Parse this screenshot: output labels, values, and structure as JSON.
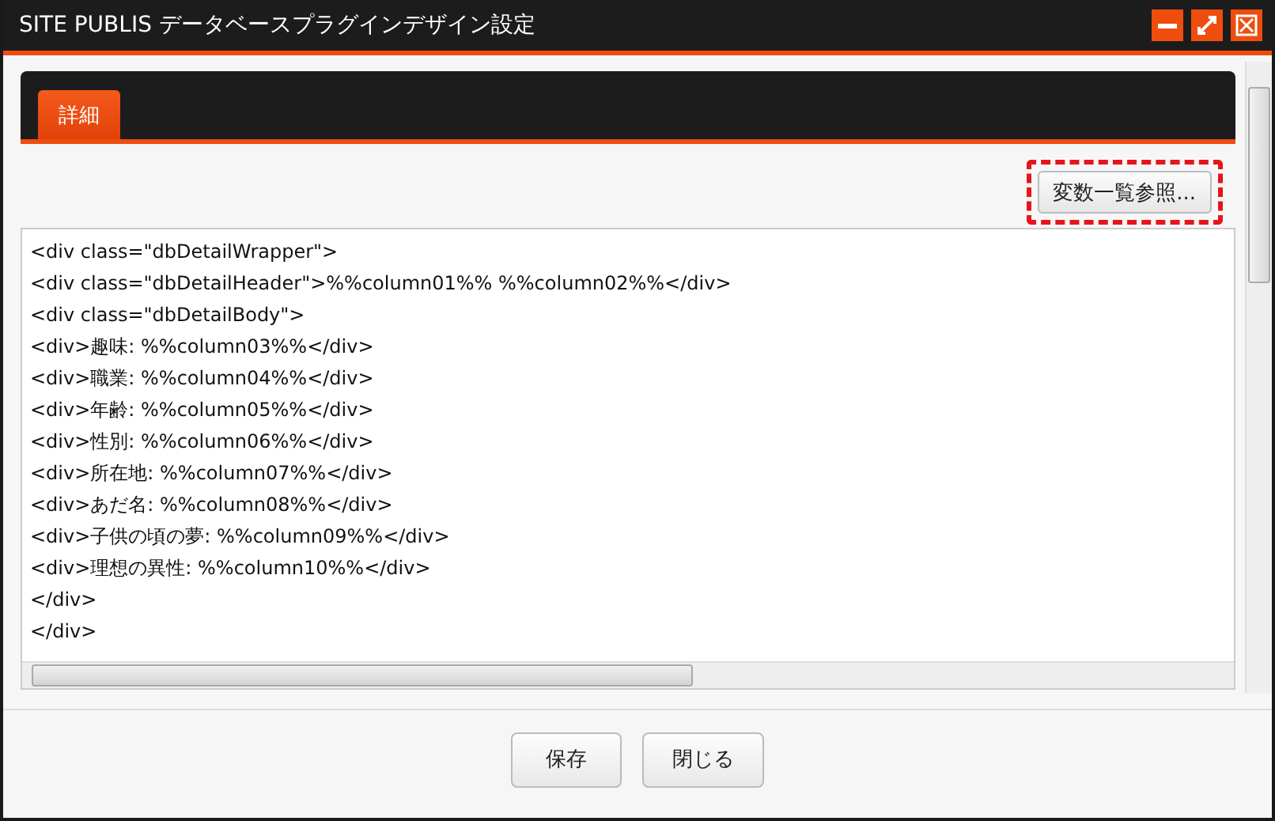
{
  "window": {
    "title": "SITE PUBLIS データベースプラグインデザイン設定",
    "controls": [
      {
        "kind": "minimize"
      },
      {
        "kind": "maximize"
      },
      {
        "kind": "close"
      }
    ]
  },
  "tabs": [
    {
      "label": "詳細",
      "selected": true
    }
  ],
  "variables_button": {
    "label": "変数一覧参照...",
    "highlighted": true
  },
  "code_lines": [
    "<div class=\"dbDetailWrapper\">",
    "<div class=\"dbDetailHeader\">%%column01%% %%column02%%</div>",
    "<div class=\"dbDetailBody\">",
    "<div>趣味: %%column03%%</div>",
    "<div>職業: %%column04%%</div>",
    "<div>年齢: %%column05%%</div>",
    "<div>性別: %%column06%%</div>",
    "<div>所在地: %%column07%%</div>",
    "<div>あだ名: %%column08%%</div>",
    "<div>子供の頃の夢: %%column09%%</div>",
    "<div>理想の異性: %%column10%%</div>",
    "</div>",
    "</div>"
  ],
  "footer_buttons": [
    "保存",
    "閉じる"
  ]
}
